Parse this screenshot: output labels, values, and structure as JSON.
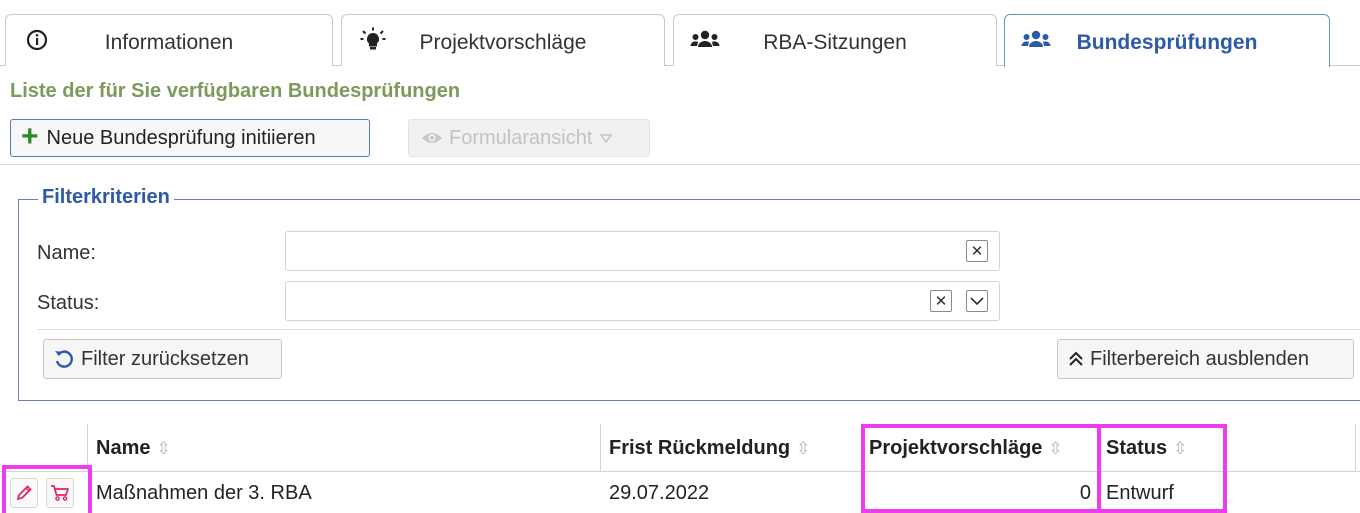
{
  "tabs": [
    {
      "label": "Informationen",
      "icon": "info-circle-icon"
    },
    {
      "label": "Projektvorschläge",
      "icon": "lightbulb-icon"
    },
    {
      "label": "RBA-Sitzungen",
      "icon": "users-icon"
    },
    {
      "label": "Bundesprüfungen",
      "icon": "users-icon",
      "active": true
    }
  ],
  "page_title": "Liste der für Sie verfügbaren Bundesprüfungen",
  "toolbar": {
    "new_label": "Neue Bundesprüfung initiieren",
    "form_view_label": "Formularansicht"
  },
  "filter": {
    "legend": "Filterkriterien",
    "name_label": "Name:",
    "name_value": "",
    "status_label": "Status:",
    "status_value": "",
    "reset_label": "Filter zurücksetzen",
    "collapse_label": "Filterbereich ausblenden"
  },
  "table": {
    "columns": [
      "Name",
      "Frist Rückmeldung",
      "Projektvorschläge",
      "Status"
    ],
    "rows": [
      {
        "name": "Maßnahmen der 3. RBA",
        "deadline": "29.07.2022",
        "proposals": "0",
        "status": "Entwurf"
      }
    ]
  },
  "colors": {
    "accent_blue": "#2d5aa8",
    "title_green": "#7c9a5c",
    "highlight_magenta": "#f03cf0",
    "action_red": "#e0245e",
    "add_green": "#2a8a2a"
  }
}
